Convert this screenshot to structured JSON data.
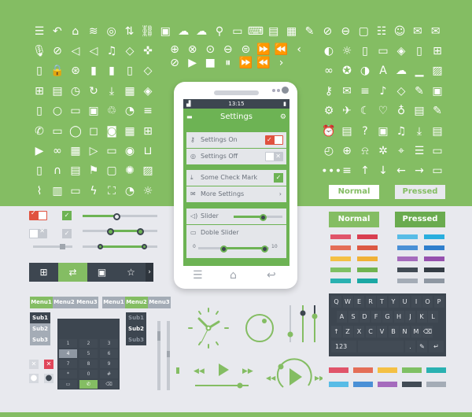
{
  "colors": {
    "green": "#84bd63",
    "accent": "#6db354",
    "dark": "#3d4650",
    "red": "#e0523f",
    "bg": "#e8e9ee"
  },
  "icons": {
    "top_row": [
      "list",
      "undo",
      "home",
      "wifi",
      "target",
      "sort",
      "link",
      "contact-card",
      "cloud-upload",
      "cloud-download",
      "pin",
      "monitor",
      "laptop",
      "radio",
      "calendar",
      "pencil",
      "block",
      "minus-circle",
      "window",
      "layout",
      "user",
      "mail-open",
      "mail"
    ],
    "left_block": [
      [
        "mic",
        "mic-off",
        "volume",
        "mute",
        "music",
        "tag-tilted",
        "gamepad"
      ],
      [
        "tablet-wifi",
        "lock",
        "steering",
        "battery-full",
        "battery-half",
        "battery-empty",
        "tag"
      ],
      [
        "apps",
        "sd-card",
        "clock",
        "refresh",
        "download",
        "chip",
        "bucket"
      ],
      [
        "file",
        "search",
        "folder",
        "save",
        "trash",
        "gauge",
        "sliders"
      ],
      [
        "phone",
        "chat",
        "speech",
        "ok-bubble",
        "camera",
        "calculator",
        "grid"
      ],
      [
        "video",
        "voicemail",
        "film",
        "play-box",
        "display",
        "eye",
        "cart"
      ],
      [
        "phone-mobile",
        "headphones",
        "clapper",
        "flag",
        "bag",
        "loader",
        "image"
      ],
      [
        "attachment",
        "book",
        "battery-charge",
        "flash",
        "fullscreen",
        "pie",
        "sun"
      ]
    ],
    "mid_rows": [
      [
        "plus-circle",
        "close-circle",
        "check-circle",
        "minus-circle",
        "pause-circle",
        "fast-forward",
        "rewind",
        "chevron-left"
      ],
      [
        "forbidden",
        "play",
        "stop",
        "pause",
        "fast-forward",
        "rewind",
        "chevron-right"
      ]
    ],
    "right_block": [
      [
        "globe-half",
        "brightness",
        "mobile",
        "tablet",
        "bucket",
        "mute-tablet",
        "grid"
      ],
      [
        "loop",
        "compass",
        "contrast",
        "text",
        "cloud",
        "chart",
        "image"
      ],
      [
        "key",
        "mail",
        "sliders",
        "music-box",
        "tag",
        "edit",
        "archive"
      ],
      [
        "gear",
        "plane",
        "moon",
        "heart",
        "bulb",
        "doc",
        "pencil"
      ],
      [
        "alarm",
        "radio",
        "question",
        "gift",
        "music",
        "download",
        "storage"
      ],
      [
        "timer",
        "globe",
        "bell",
        "atom",
        "location",
        "menu",
        "tv"
      ],
      [
        "dots",
        "lines",
        "arrow-up",
        "arrow-down",
        "arrow-left",
        "arrow-right",
        "tv"
      ]
    ]
  },
  "phone": {
    "time": "13:15",
    "title": "Settings",
    "rows": [
      {
        "label": "Settings On",
        "icon": "key-icon"
      },
      {
        "label": "Settings Off",
        "icon": "shield-icon"
      },
      {
        "label": "Some Check Mark",
        "icon": "download-icon"
      },
      {
        "label": "More Settings",
        "icon": "mail-icon"
      },
      {
        "label": "Slider",
        "icon": "volume-icon"
      },
      {
        "label": "Doble Slider",
        "icon": "display-icon"
      }
    ],
    "slider_value": 0.6,
    "double_slider": {
      "min_label": "0",
      "max_label": "10",
      "low": 3.5,
      "high": 9.3
    },
    "more_chevron": "›"
  },
  "buttons": {
    "normal": "Normal",
    "pressed": "Pressed"
  },
  "swatches_left": [
    "#e0546a",
    "#d93e50",
    "#e46e57",
    "#dc5944",
    "#f4c044",
    "#f0b136",
    "#7fc063",
    "#70b34f",
    "#2ab1b1",
    "#1ba8a4"
  ],
  "swatches_right": [
    "#58bce6",
    "#2aaede",
    "#4a90d6",
    "#2f7fcd",
    "#a56bbd",
    "#9650ae",
    "#424b55",
    "#343c45",
    "#a4acb6",
    "#8e97a2"
  ],
  "menus": {
    "left": [
      "Menu1",
      "Menu2",
      "Menu3"
    ],
    "left_active": 0,
    "left_subs": [
      "Sub1",
      "Sub2",
      "Sub3"
    ],
    "right": [
      "Menu1",
      "Menu2",
      "Menu3"
    ],
    "right_active": 1,
    "right_subs": [
      "Sub1",
      "Sub2",
      "Sub3"
    ]
  },
  "keypad": [
    [
      "1",
      ""
    ],
    [
      "2",
      "ABC"
    ],
    [
      "3",
      "DEF"
    ],
    [
      "4",
      "GHI"
    ],
    [
      "5",
      "JKL"
    ],
    [
      "6",
      "MNO"
    ],
    [
      "7",
      "PQRS"
    ],
    [
      "8",
      "TUV"
    ],
    [
      "9",
      "WXYZ"
    ],
    [
      "*",
      ""
    ],
    [
      "0",
      "+"
    ],
    [
      "#",
      ""
    ]
  ],
  "keyboard": {
    "rows": [
      [
        "Q",
        "W",
        "E",
        "R",
        "T",
        "Y",
        "U",
        "I",
        "O",
        "P"
      ],
      [
        "A",
        "S",
        "D",
        "F",
        "G",
        "H",
        "J",
        "K",
        "L"
      ],
      [
        "↑",
        "Z",
        "X",
        "C",
        "V",
        "B",
        "N",
        "M",
        "⌫"
      ]
    ],
    "bottom": [
      "123",
      "",
      ".",
      "✎",
      "↵"
    ]
  },
  "toolbar": [
    "grid-icon",
    "swap-icon",
    "contacts-icon",
    "star-icon",
    "chevron-right-icon"
  ]
}
